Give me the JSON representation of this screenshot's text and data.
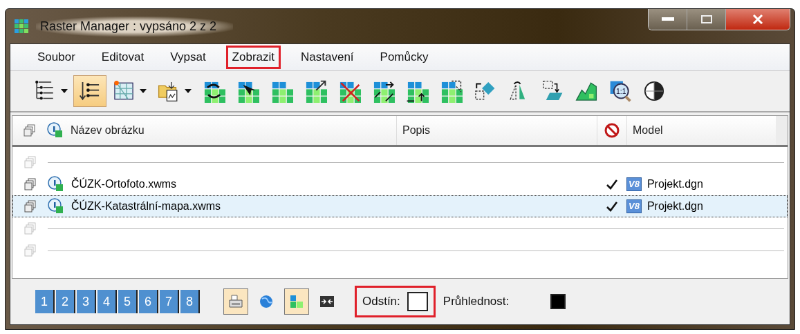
{
  "window": {
    "title": "Raster Manager : vypsáno 2 z 2"
  },
  "menu": [
    {
      "label": "Soubor",
      "highlighted": false
    },
    {
      "label": "Editovat",
      "highlighted": false
    },
    {
      "label": "Vypsat",
      "highlighted": false
    },
    {
      "label": "Zobrazit",
      "highlighted": true
    },
    {
      "label": "Nastavení",
      "highlighted": false
    },
    {
      "label": "Pomůcky",
      "highlighted": false
    }
  ],
  "toolbar": [
    {
      "kind": "outline",
      "pressed": false,
      "dropdown": true
    },
    {
      "kind": "sorted",
      "pressed": true,
      "dropdown": false
    },
    {
      "kind": "map",
      "pressed": false,
      "dropdown": true
    },
    {
      "kind": "folder",
      "pressed": false,
      "dropdown": true
    },
    {
      "kind": "swap",
      "pressed": false,
      "dropdown": false
    },
    {
      "kind": "select",
      "pressed": false,
      "dropdown": false
    },
    {
      "kind": "blocks",
      "pressed": false,
      "dropdown": false
    },
    {
      "kind": "scale",
      "pressed": false,
      "dropdown": false
    },
    {
      "kind": "delete",
      "pressed": false,
      "dropdown": false
    },
    {
      "kind": "move",
      "pressed": false,
      "dropdown": false
    },
    {
      "kind": "raise",
      "pressed": false,
      "dropdown": false
    },
    {
      "kind": "corner",
      "pressed": false,
      "dropdown": false
    },
    {
      "kind": "rotate",
      "pressed": false,
      "dropdown": false
    },
    {
      "kind": "mirror",
      "pressed": false,
      "dropdown": false
    },
    {
      "kind": "drop",
      "pressed": false,
      "dropdown": false
    },
    {
      "kind": "terrain",
      "pressed": false,
      "dropdown": false
    },
    {
      "kind": "zoom",
      "pressed": false,
      "dropdown": false,
      "label": "1:1"
    },
    {
      "kind": "contrast",
      "pressed": false,
      "dropdown": false
    }
  ],
  "table": {
    "columns": [
      "Název obrázku",
      "Popis",
      "Model"
    ],
    "rows": [
      {
        "kind": "empty",
        "selected": false
      },
      {
        "kind": "raster",
        "name": "ČÚZK-Ortofoto.xwms",
        "checked": true,
        "model_badge": "V8",
        "model": "Projekt.dgn",
        "selected": false
      },
      {
        "kind": "raster",
        "name": "ČÚZK-Katastrální-mapa.xwms",
        "checked": true,
        "model_badge": "V8",
        "model": "Projekt.dgn",
        "selected": true
      },
      {
        "kind": "empty",
        "selected": false
      },
      {
        "kind": "empty",
        "selected": false
      }
    ]
  },
  "pages": [
    "1",
    "2",
    "3",
    "4",
    "5",
    "6",
    "7",
    "8"
  ],
  "tools": [
    {
      "kind": "print",
      "pressed": true
    },
    {
      "kind": "globe",
      "pressed": false
    },
    {
      "kind": "raster",
      "pressed": true
    },
    {
      "kind": "arrows",
      "pressed": false
    }
  ],
  "color_fields": [
    {
      "label": "Odstín:",
      "color": "#ffffff",
      "highlighted": true
    },
    {
      "label": "Průhlednost:",
      "color": "#000000",
      "highlighted": false
    }
  ]
}
